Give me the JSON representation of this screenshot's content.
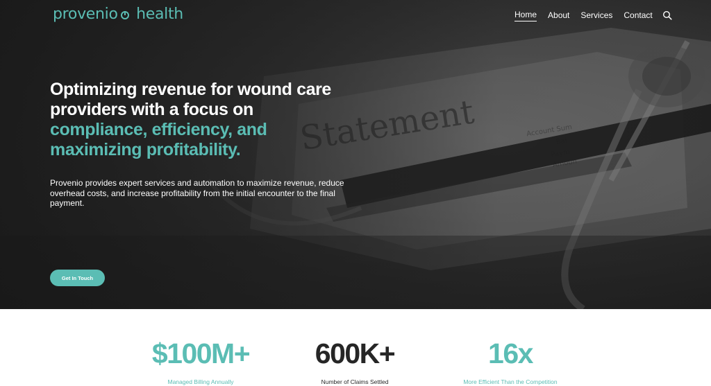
{
  "brand": {
    "name": "provenio",
    "sub": "health",
    "color": "#5bbdb4"
  },
  "nav": {
    "items": [
      {
        "label": "Home",
        "active": true
      },
      {
        "label": "About",
        "active": false
      },
      {
        "label": "Services",
        "active": false
      },
      {
        "label": "Contact",
        "active": false
      }
    ],
    "search_icon": "search-icon"
  },
  "hero": {
    "headline_line1": "Optimizing revenue for wound care",
    "headline_line2": "providers with a focus on",
    "headline_accent1": "compliance, efficiency, and",
    "headline_accent2": "maximizing profitability.",
    "description": "Provenio provides expert services and automation to maximize revenue, reduce overhead costs, and increase profitability from the initial encounter to the final payment.",
    "cta_label": "Get In Touch"
  },
  "stats": [
    {
      "value": "$100M+",
      "label": "Managed Billing Annually",
      "color": "#5bbdb4"
    },
    {
      "value": "600K+",
      "label": "Number of Claims Settled",
      "color": "#262626"
    },
    {
      "value": "16x",
      "label": "More Efficient Than the Competition",
      "color": "#5bbdb4"
    }
  ],
  "colors": {
    "accent": "#5bbdb4",
    "hero_bg": "#2e2e2e",
    "text_dark": "#262626"
  }
}
